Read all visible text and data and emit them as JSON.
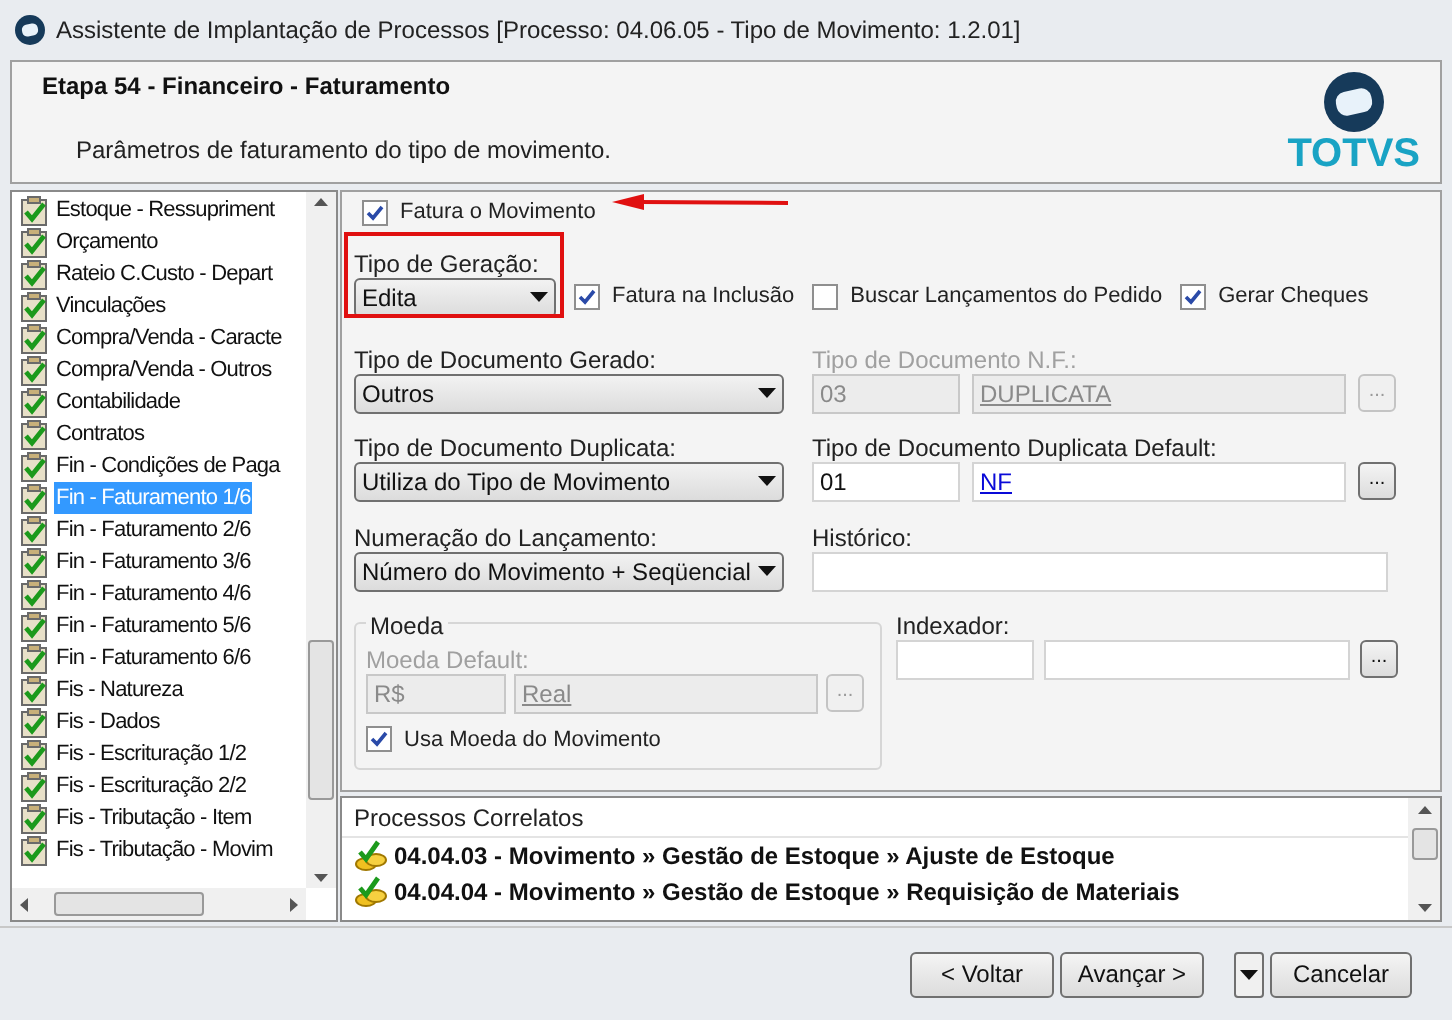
{
  "window": {
    "title": "Assistente de Implantação de Processos [Processo: 04.06.05 - Tipo de Movimento: 1.2.01]"
  },
  "header": {
    "title": "Etapa 54 - Financeiro - Faturamento",
    "subtitle": "Parâmetros de faturamento do tipo de movimento.",
    "logo": "TOTVS"
  },
  "steps": [
    {
      "label": "Estoque - Ressupriment",
      "selected": false
    },
    {
      "label": "Orçamento",
      "selected": false
    },
    {
      "label": "Rateio C.Custo - Depart",
      "selected": false
    },
    {
      "label": "Vinculações",
      "selected": false
    },
    {
      "label": "Compra/Venda - Caracte",
      "selected": false
    },
    {
      "label": "Compra/Venda - Outros",
      "selected": false
    },
    {
      "label": "Contabilidade",
      "selected": false
    },
    {
      "label": "Contratos",
      "selected": false
    },
    {
      "label": "Fin - Condições de Paga",
      "selected": false
    },
    {
      "label": "Fin - Faturamento 1/6",
      "selected": true
    },
    {
      "label": "Fin - Faturamento 2/6",
      "selected": false
    },
    {
      "label": "Fin - Faturamento 3/6",
      "selected": false
    },
    {
      "label": "Fin - Faturamento 4/6",
      "selected": false
    },
    {
      "label": "Fin - Faturamento 5/6",
      "selected": false
    },
    {
      "label": "Fin - Faturamento 6/6",
      "selected": false
    },
    {
      "label": "Fis - Natureza",
      "selected": false
    },
    {
      "label": "Fis - Dados",
      "selected": false
    },
    {
      "label": "Fis - Escrituração 1/2",
      "selected": false
    },
    {
      "label": "Fis - Escrituração 2/2",
      "selected": false
    },
    {
      "label": "Fis - Tributação - Item",
      "selected": false
    },
    {
      "label": "Fis - Tributação - Movim",
      "selected": false
    }
  ],
  "form": {
    "fatura_movimento": {
      "label": "Fatura o Movimento",
      "checked": true
    },
    "tipo_geracao": {
      "label": "Tipo de Geração:",
      "value": "Edita"
    },
    "options": [
      {
        "label": "Fatura na Inclusão",
        "checked": true
      },
      {
        "label": "Buscar Lançamentos do Pedido",
        "checked": false
      },
      {
        "label": "Gerar Cheques",
        "checked": true
      }
    ],
    "tipo_documento_gerado": {
      "label": "Tipo de Documento Gerado:",
      "value": "Outros"
    },
    "tipo_documento_nf": {
      "label": "Tipo de Documento N.F.:",
      "code": "03",
      "name": "DUPLICATA",
      "disabled": true
    },
    "tipo_documento_duplicata": {
      "label": "Tipo de Documento Duplicata:",
      "value": "Utiliza do Tipo de Movimento"
    },
    "tipo_documento_duplicata_default": {
      "label": "Tipo de Documento Duplicata Default:",
      "code": "01",
      "name": "NF",
      "disabled": false
    },
    "numeracao": {
      "label": "Numeração do Lançamento:",
      "value": "Número do Movimento + Seqüencial"
    },
    "historico": {
      "label": "Histórico:"
    },
    "moeda": {
      "title": "Moeda",
      "default_label": "Moeda Default:",
      "code": "R$",
      "name": "Real",
      "disabled": true,
      "usa_moeda": {
        "label": "Usa Moeda do Movimento",
        "checked": true
      }
    },
    "indexador": {
      "label": "Indexador:"
    },
    "browse_button": "..."
  },
  "related": {
    "title": "Processos Correlatos",
    "items": [
      "04.04.03 - Movimento » Gestão de Estoque » Ajuste de Estoque",
      "04.04.04 - Movimento » Gestão de Estoque » Requisição de Materiais"
    ]
  },
  "buttons": {
    "back": "< Voltar",
    "next": "Avançar >",
    "cancel": "Cancelar"
  }
}
